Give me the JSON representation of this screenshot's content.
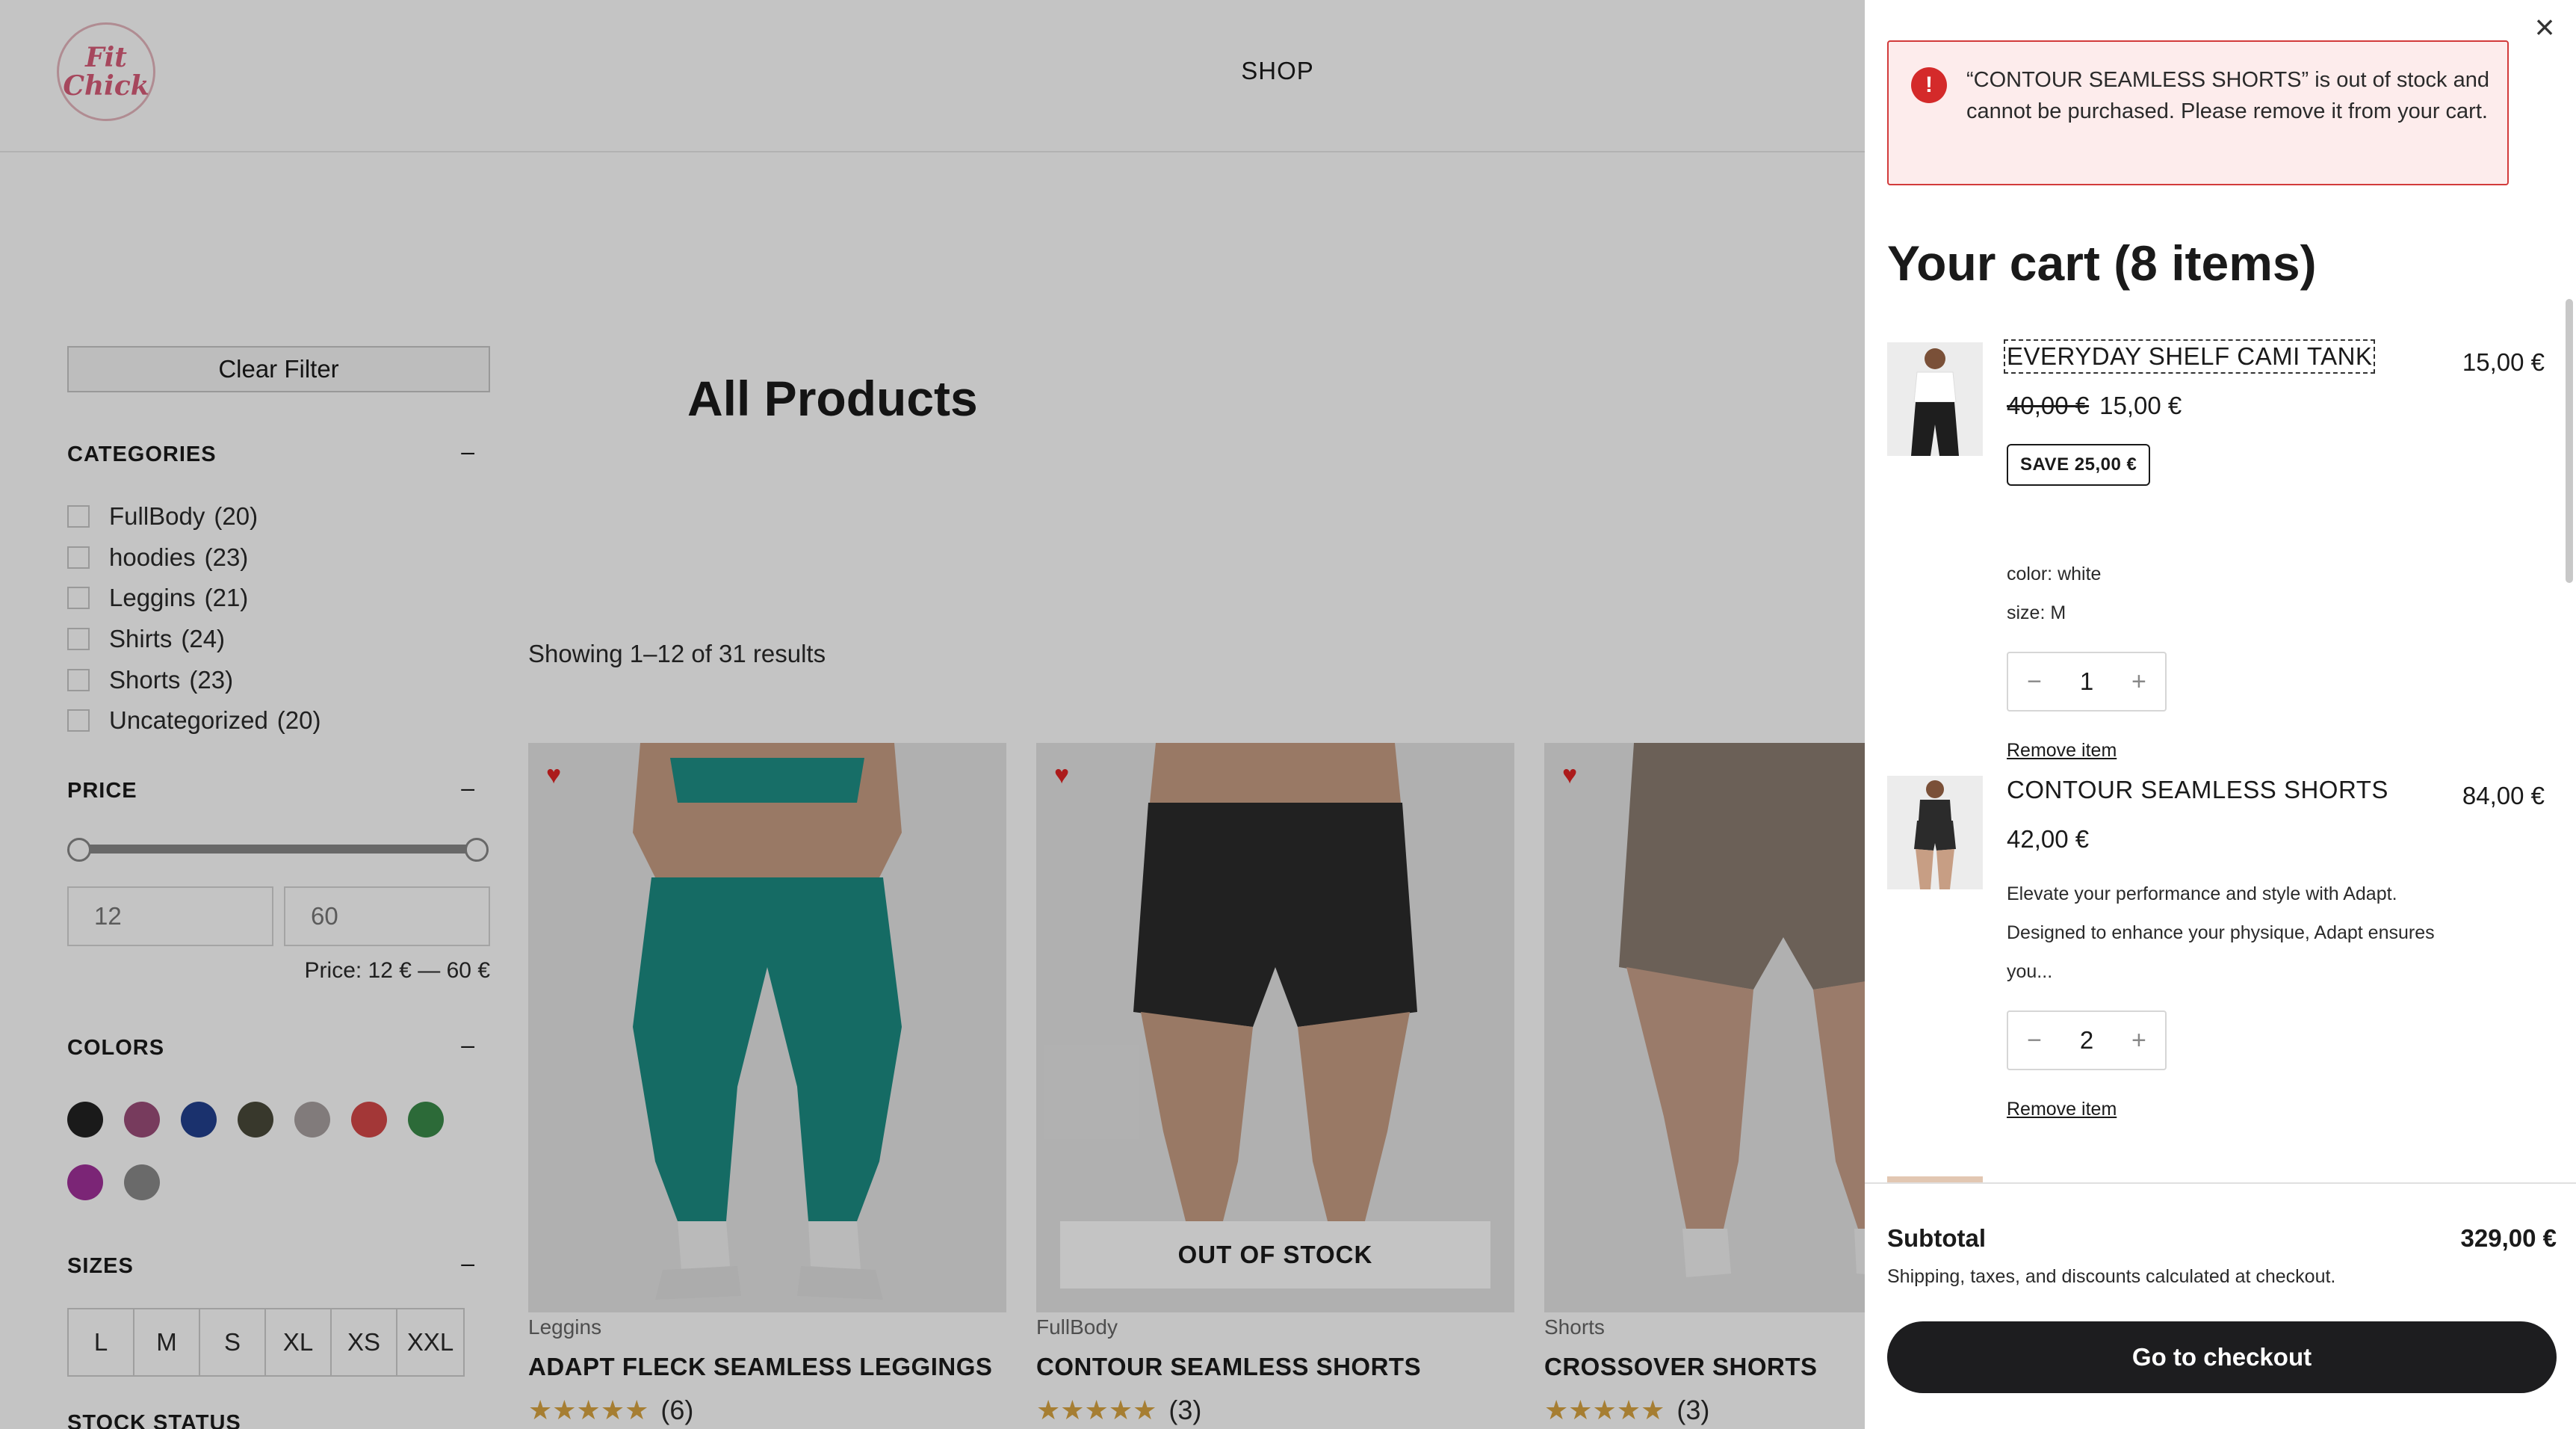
{
  "header": {
    "logo_text": "Fit Chick",
    "nav_shop": "SHOP"
  },
  "filters": {
    "clear_filter": "Clear Filter",
    "categories_heading": "CATEGORIES",
    "categories": [
      {
        "name": "FullBody",
        "count": "(20)"
      },
      {
        "name": "hoodies",
        "count": "(23)"
      },
      {
        "name": "Leggins",
        "count": "(21)"
      },
      {
        "name": "Shirts",
        "count": "(24)"
      },
      {
        "name": "Shorts",
        "count": "(23)"
      },
      {
        "name": "Uncategorized",
        "count": "(20)"
      }
    ],
    "price_heading": "PRICE",
    "price_min": "12",
    "price_max": "60",
    "price_range_text": "Price:  12 € — 60 €",
    "colors_heading": "COLORS",
    "colors": [
      "#222222",
      "#9b4d7a",
      "#23408e",
      "#4a4a3a",
      "#a8a0a0",
      "#d44848",
      "#3a8a4a",
      "#a0319a",
      "#8a8a8a"
    ],
    "sizes_heading": "SIZES",
    "sizes": [
      "L",
      "M",
      "S",
      "XL",
      "XS",
      "XXL"
    ],
    "stock_heading": "STOCK STATUS",
    "collapse_symbol": "–"
  },
  "main": {
    "title": "All Products",
    "results_text": "Showing 1–12 of 31 results",
    "products": [
      {
        "category": "Leggins",
        "name": "ADAPT FLECK SEAMLESS LEGGINGS",
        "reviews": "(6)",
        "out_of_stock": false
      },
      {
        "category": "FullBody",
        "name": "CONTOUR SEAMLESS SHORTS",
        "reviews": "(3)",
        "out_of_stock": true,
        "badge": "OUT OF STOCK"
      },
      {
        "category": "Shorts",
        "name": "CROSSOVER SHORTS",
        "reviews": "(3)",
        "out_of_stock": false
      }
    ]
  },
  "cart": {
    "alert_text": "“CONTOUR SEAMLESS SHORTS” is out of stock and cannot be purchased. Please remove it from your cart.",
    "title": "Your cart (8 items)",
    "items": [
      {
        "name": "EVERYDAY SHELF CAMI TANK",
        "line_total": "15,00 €",
        "original_price": "40,00 €",
        "unit_price": "15,00 €",
        "save_badge": "SAVE 25,00 €",
        "color": "color: white",
        "size": "size: M",
        "quantity": "1",
        "remove": "Remove item"
      },
      {
        "name": "CONTOUR SEAMLESS SHORTS",
        "line_total": "84,00 €",
        "unit_price": "42,00 €",
        "description_lines": [
          "Elevate your performance and style with Adapt.",
          "Designed to enhance your physique, Adapt ensures",
          "you..."
        ],
        "quantity": "2",
        "remove": "Remove item"
      }
    ],
    "subtotal_label": "Subtotal",
    "subtotal_value": "329,00 €",
    "shipping_note": "Shipping, taxes, and discounts calculated at checkout.",
    "checkout_button": "Go to checkout",
    "qty_minus": "−",
    "qty_plus": "+"
  }
}
